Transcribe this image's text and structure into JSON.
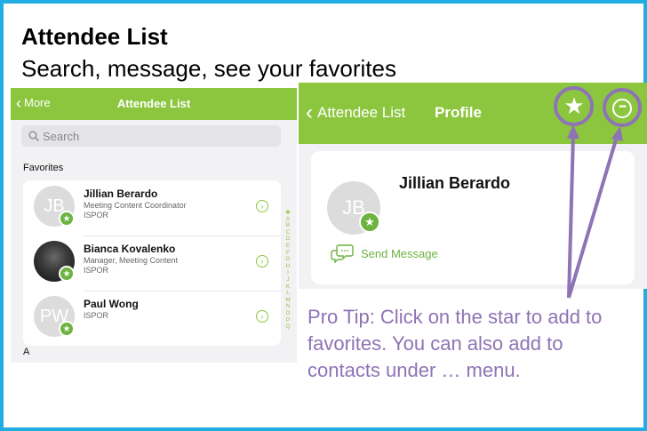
{
  "slide": {
    "title": "Attendee List",
    "subtitle": "Search, message, see your favorites",
    "pro_tip": "Pro Tip: Click on the star to add to favorites. You can also add to contacts under … menu."
  },
  "list_screen": {
    "nav": {
      "back_label": "More",
      "title": "Attendee List"
    },
    "search": {
      "placeholder": "Search",
      "value": ""
    },
    "favorites_header": "Favorites",
    "attendees": [
      {
        "initials": "JB",
        "name": "Jillian Berardo",
        "line2": "Meeting Content Coordinator",
        "line3": "ISPOR",
        "has_photo": false
      },
      {
        "initials": "",
        "name": "Bianca Kovalenko",
        "line2": "Manager, Meeting Content",
        "line3": "ISPOR",
        "has_photo": true
      },
      {
        "initials": "PW",
        "name": "Paul Wong",
        "line2": "ISPOR",
        "line3": "",
        "has_photo": false
      }
    ],
    "section_a": "A",
    "alphabet_index": [
      "★",
      "A",
      "B",
      "C",
      "D",
      "E",
      "F",
      "G",
      "H",
      "I",
      "J",
      "K",
      "L",
      "M",
      "N",
      "O",
      "P",
      "Q"
    ]
  },
  "profile_screen": {
    "nav": {
      "back_label": "Attendee List",
      "title": "Profile"
    },
    "initials": "JB",
    "name": "Jillian Berardo",
    "send_message_label": "Send Message"
  },
  "icons": {
    "favorite": "star-icon",
    "more": "ellipsis-circle-icon",
    "message": "chat-bubble-icon",
    "badge": "star-badge-icon",
    "row_action": "chevron-circle-icon"
  },
  "colors": {
    "frame": "#22aee3",
    "accent_green": "#8cc63f",
    "badge_green": "#6cb33f",
    "callout_purple": "#8e73b5"
  }
}
